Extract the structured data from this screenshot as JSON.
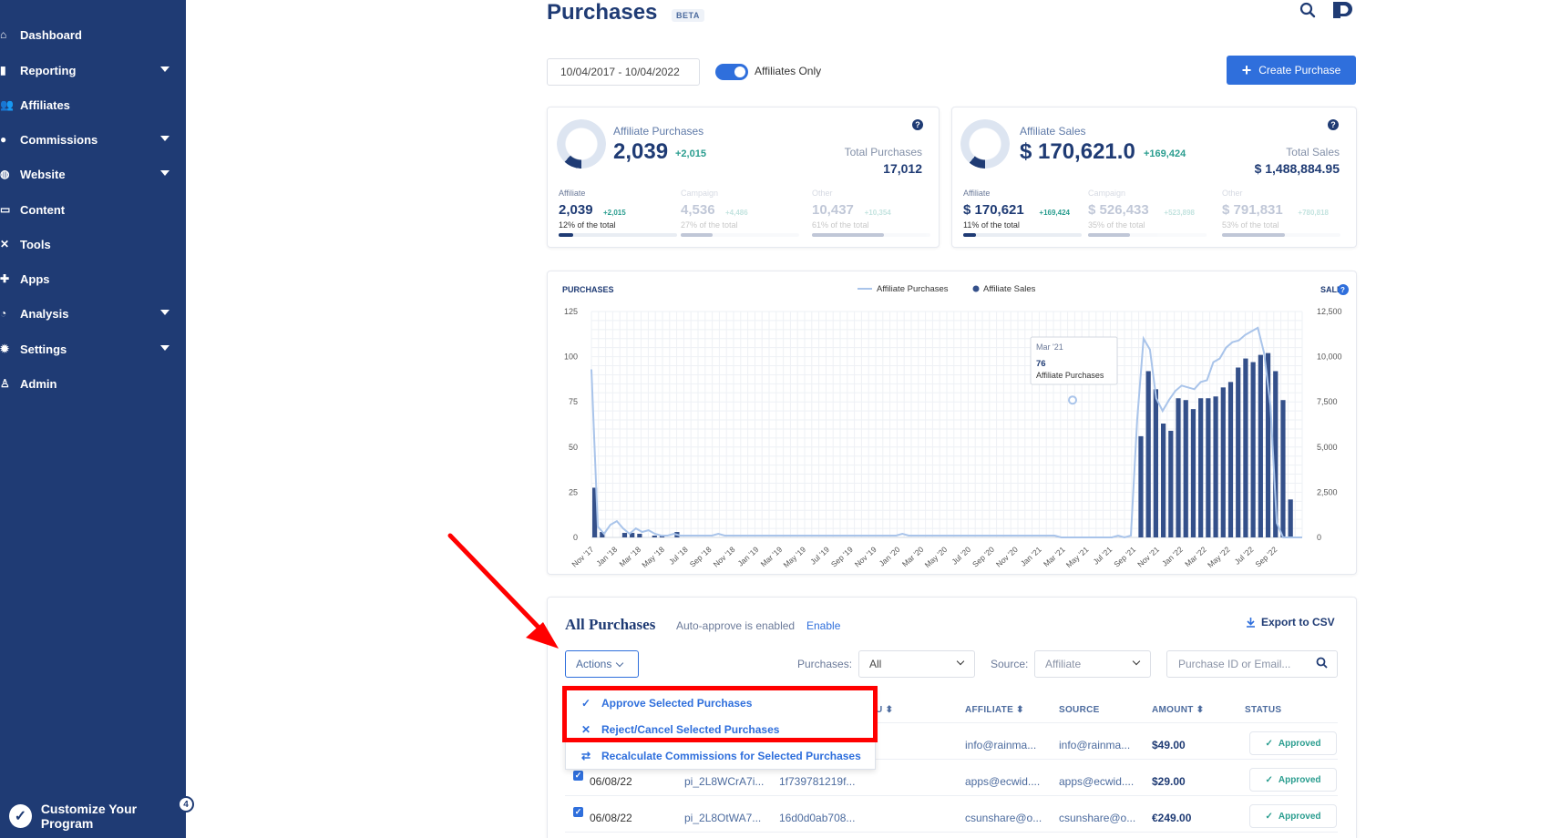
{
  "sidebar": {
    "items": [
      {
        "label": "Dashboard",
        "icon": "home-icon",
        "has_caret": false
      },
      {
        "label": "Reporting",
        "icon": "bar-chart-icon",
        "has_caret": true
      },
      {
        "label": "Affiliates",
        "icon": "users-icon",
        "has_caret": false
      },
      {
        "label": "Commissions",
        "icon": "coins-icon",
        "has_caret": true
      },
      {
        "label": "Website",
        "icon": "globe-icon",
        "has_caret": true
      },
      {
        "label": "Content",
        "icon": "image-icon",
        "has_caret": false
      },
      {
        "label": "Tools",
        "icon": "tools-icon",
        "has_caret": false
      },
      {
        "label": "Apps",
        "icon": "puzzle-icon",
        "has_caret": false
      },
      {
        "label": "Analysis",
        "icon": "pie-chart-icon",
        "has_caret": true
      },
      {
        "label": "Settings",
        "icon": "gear-icon",
        "has_caret": true
      },
      {
        "label": "Admin",
        "icon": "user-gear-icon",
        "has_caret": false
      }
    ],
    "customize_label": "Customize Your Program",
    "customize_badge": "4"
  },
  "header": {
    "title": "Purchases",
    "beta": "BETA",
    "date_range": "10/04/2017 - 10/04/2022",
    "toggle_label": "Affiliates Only",
    "toggle_on": true,
    "create_label": "Create Purchase"
  },
  "purchases_card": {
    "label": "Affiliate Purchases",
    "value": "2,039",
    "delta": "+2,015",
    "total_label": "Total Purchases",
    "total_value": "17,012",
    "donut_fraction": 0.12,
    "subs": [
      {
        "label": "Affiliate",
        "value": "2,039",
        "delta": "+2,015",
        "pct": "12% of the total",
        "fraction": 0.12
      },
      {
        "label": "Campaign",
        "value": "4,536",
        "delta": "+4,486",
        "pct": "27% of the total",
        "fraction": 0.27
      },
      {
        "label": "Other",
        "value": "10,437",
        "delta": "+10,354",
        "pct": "61% of the total",
        "fraction": 0.61
      }
    ]
  },
  "sales_card": {
    "label": "Affiliate Sales",
    "value": "$ 170,621.0",
    "delta": "+169,424",
    "total_label": "Total Sales",
    "total_value": "$ 1,488,884.95",
    "donut_fraction": 0.11,
    "subs": [
      {
        "label": "Affiliate",
        "value": "$ 170,621",
        "delta": "+169,424",
        "pct": "11% of the total",
        "fraction": 0.11
      },
      {
        "label": "Campaign",
        "value": "$ 526,433",
        "delta": "+523,898",
        "pct": "35% of the total",
        "fraction": 0.35
      },
      {
        "label": "Other",
        "value": "$ 791,831",
        "delta": "+780,818",
        "pct": "53% of the total",
        "fraction": 0.53
      }
    ]
  },
  "chart_data": {
    "type": "bar",
    "left_axis_title": "PURCHASES",
    "right_axis_title": "SALES",
    "legend": [
      {
        "name": "Affiliate Purchases",
        "style": "line"
      },
      {
        "name": "Affiliate Sales",
        "style": "bar"
      }
    ],
    "left_ticks": [
      "125",
      "100",
      "75",
      "50",
      "25",
      "0"
    ],
    "right_ticks": [
      "12,500",
      "10,000",
      "7,500",
      "5,000",
      "2,500",
      "0"
    ],
    "ylim_left": [
      0,
      125
    ],
    "ylim_right": [
      0,
      12500
    ],
    "x_labels": [
      "Nov '17",
      "Jan '18",
      "Mar '18",
      "May '18",
      "Jul '18",
      "Sep '18",
      "Nov '18",
      "Jan '19",
      "Mar '19",
      "May '19",
      "Jul '19",
      "Sep '19",
      "Nov '19",
      "Jan '20",
      "Mar '20",
      "May '20",
      "Jul '20",
      "Sep '20",
      "Nov '20",
      "Jan '21",
      "Mar '21",
      "May '21",
      "Jul '21",
      "Sep '21",
      "Nov '21",
      "Jan '22",
      "Mar '22",
      "May '22",
      "Jul '22",
      "Sep '22"
    ],
    "series": [
      {
        "name": "Affiliate Purchases",
        "type": "line",
        "color": "#a9c4ea",
        "values": [
          93,
          6,
          2,
          7,
          9,
          5,
          2,
          5,
          3,
          4,
          2,
          1,
          1,
          2,
          1,
          1,
          1,
          1,
          1,
          1,
          2,
          1,
          1,
          1,
          1,
          1,
          1,
          1,
          1,
          1,
          1,
          1,
          1,
          1,
          1,
          1,
          1,
          1,
          1,
          1,
          1,
          1,
          1,
          1,
          1,
          1,
          1,
          1,
          1,
          2,
          1,
          1,
          1,
          1,
          1,
          1,
          1,
          1,
          1,
          1,
          1,
          1,
          1,
          1,
          1,
          1,
          1,
          1,
          1,
          1,
          1,
          1,
          1,
          1,
          0,
          0,
          0,
          0,
          0,
          0,
          0,
          0,
          0,
          1,
          0,
          1,
          65,
          110,
          104,
          77,
          70,
          76,
          81,
          84,
          83,
          82,
          86,
          87,
          97,
          99,
          105,
          108,
          109,
          112,
          114,
          116,
          102,
          73,
          8,
          0,
          0,
          0,
          0
        ]
      },
      {
        "name": "Affiliate Sales",
        "type": "bar",
        "color": "#34508a",
        "values": [
          2750,
          300,
          0,
          0,
          250,
          250,
          200,
          0,
          100,
          100,
          0,
          300,
          0,
          0,
          0,
          0,
          0,
          0,
          0,
          0,
          0,
          0,
          0,
          0,
          0,
          0,
          0,
          0,
          0,
          0,
          0,
          0,
          0,
          0,
          0,
          0,
          0,
          0,
          0,
          0,
          0,
          0,
          0,
          0,
          0,
          0,
          0,
          0,
          0,
          0,
          0,
          0,
          0,
          0,
          0,
          0,
          0,
          0,
          0,
          0,
          0,
          0,
          0,
          0,
          0,
          0,
          0,
          0,
          0,
          0,
          0,
          0,
          0,
          5600,
          9200,
          8200,
          6300,
          5900,
          7700,
          7600,
          7100,
          7700,
          7700,
          7800,
          8300,
          8600,
          9400,
          9900,
          9700,
          10100,
          10200,
          9200,
          7600,
          2100,
          0
        ]
      }
    ],
    "tooltip": {
      "title": "Mar '21",
      "value": "76",
      "series": "Affiliate Purchases"
    }
  },
  "table": {
    "title": "All Purchases",
    "auto_approve": "Auto-approve is enabled",
    "enable": "Enable",
    "export": "Export to CSV",
    "actions": "Actions",
    "purchases_filter_label": "Purchases:",
    "purchases_filter_value": "All",
    "source_filter_label": "Source:",
    "source_filter_value": "Affiliate",
    "search_placeholder": "Purchase ID or Email...",
    "headers": {
      "sku": "U ⬍",
      "affiliate": "AFFILIATE ⬍",
      "source": "SOURCE",
      "amount": "AMOUNT ⬍",
      "status": "STATUS"
    },
    "rows": [
      {
        "date": "",
        "id": "",
        "sku": "",
        "affiliate": "info@rainma...",
        "source": "info@rainma...",
        "amount": "$49.00",
        "status": "Approved"
      },
      {
        "date": "06/08/22",
        "id": "pi_2L8WCrA7i...",
        "sku": "1f739781219f...",
        "affiliate": "apps@ecwid....",
        "source": "apps@ecwid....",
        "amount": "$29.00",
        "status": "Approved"
      },
      {
        "date": "06/08/22",
        "id": "pi_2L8OtWA7...",
        "sku": "16d0d0ab708...",
        "affiliate": "csunshare@o...",
        "source": "csunshare@o...",
        "amount": "€249.00",
        "status": "Approved"
      }
    ]
  },
  "actions_menu": {
    "items": [
      {
        "label": "Approve Selected Purchases",
        "icon": "check-icon"
      },
      {
        "label": "Reject/Cancel Selected Purchases",
        "icon": "x-icon"
      },
      {
        "label": "Recalculate Commissions for Selected Purchases",
        "icon": "refresh-icon"
      }
    ]
  },
  "colors": {
    "sidebar": "#1f3b74",
    "accent": "#2f6fdc",
    "bar": "#34508a",
    "line": "#a9c4ea",
    "annotation": "#ff0000",
    "approved": "#2a9d8f"
  }
}
